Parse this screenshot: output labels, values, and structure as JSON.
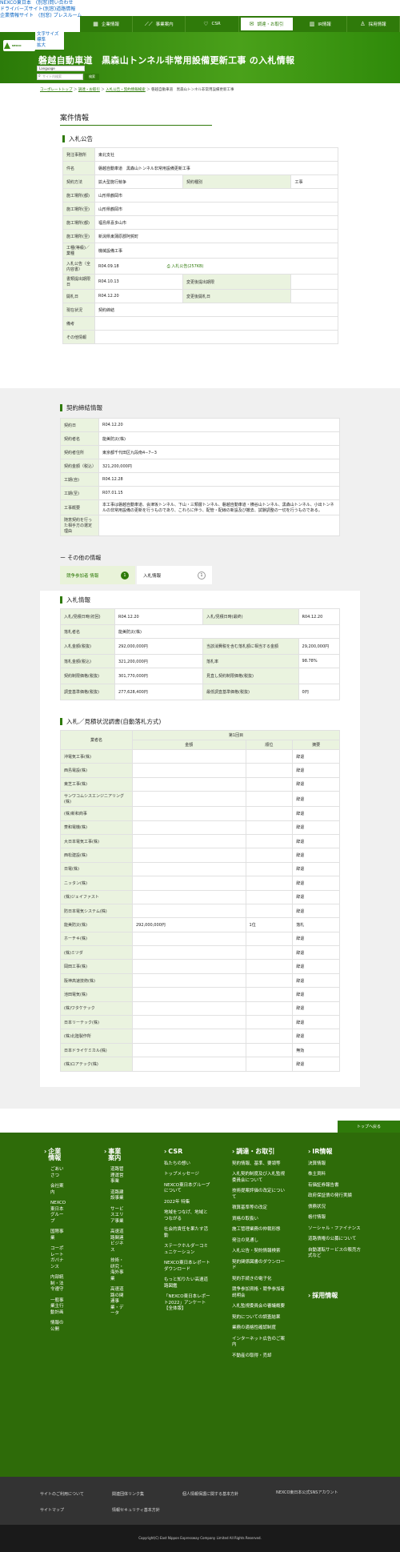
{
  "skip_links": [
    "NEXCO東日本　(別窓)問い合わせ",
    "ドライバーズサイト(別窓)道路情報",
    "企業情報サイト　(別窓) プレスルーム"
  ],
  "font_size": {
    "label": "文字サイズ",
    "standard": "標準",
    "large": "拡大"
  },
  "nav": [
    {
      "icon": "▦",
      "label": "企業情報"
    },
    {
      "icon": "⟋⟋",
      "label": "事業案内"
    },
    {
      "icon": "♡",
      "label": "CSR"
    },
    {
      "icon": "✉",
      "label": "調達・お取引"
    },
    {
      "icon": "▥",
      "label": "IR情報"
    },
    {
      "icon": "♙",
      "label": "採用情報"
    }
  ],
  "hero": {
    "title": "磐越自動車道　黒森山トンネル非常用設備更新工事 の入札情報"
  },
  "search": {
    "language": "Language",
    "placeholder": "サイト内検索",
    "button": "検索"
  },
  "breadcrumb": [
    "コーポレートトップ",
    "調達・お取引",
    "入札公告・契約情報検索",
    "磐越自動車道　黒森山トンネル非常用設備更新工事"
  ],
  "page_title": "案件情報",
  "notice": {
    "title": "入札公告",
    "rows": [
      {
        "label": "発注事務所",
        "value": "東北支社"
      },
      {
        "label": "件名",
        "value": "磐越自動車道　黒森山トンネル非常用設備更新工事"
      },
      {
        "label": "契約方法",
        "value": "拡大型施行競争",
        "label2": "契約種別",
        "value2": "工事"
      },
      {
        "label": "施工場所(都)",
        "value": "山形県鶴岡市"
      },
      {
        "label": "施工場所(至)",
        "value": "山形県鶴岡市"
      },
      {
        "label": "施工場所(都)",
        "value": "福島県喜多山市"
      },
      {
        "label": "施工場所(至)",
        "value": "新潟県東蒲原郡阿賀町"
      },
      {
        "label": "工種(等級)／業種",
        "value": "機械設備工事"
      },
      {
        "label": "入札公告（全内容書）",
        "value": "R04.09.18",
        "attach": "入札公告(257KB)"
      },
      {
        "label": "書類提出期限日",
        "value": "R04.10.13",
        "label2": "変更後提出期限",
        "value2": ""
      },
      {
        "label": "開札日",
        "value": "R04.12.20",
        "label2": "変更後開札日",
        "value2": ""
      },
      {
        "label": "現在状況",
        "value": "契約締結"
      },
      {
        "label": "備考",
        "value": ""
      },
      {
        "label": "その他情報",
        "value": ""
      }
    ]
  },
  "contract": {
    "title": "契約締結情報",
    "rows": [
      {
        "label": "契約日",
        "value": "R04.12.20"
      },
      {
        "label": "契約者名",
        "value": "能美防災(株)"
      },
      {
        "label": "契約者住所",
        "value": "東京都千代田区九段南4−7−3"
      },
      {
        "label": "契約金額（税込）",
        "value": "321,200,000円"
      },
      {
        "label": "工期(自)",
        "value": "R04.12.28"
      },
      {
        "label": "工期(至)",
        "value": "R07.01.15"
      },
      {
        "label": "工事概要",
        "value": "本工事は磐越自動車道、会津坂トンネル、下山・三類層トンネル、磐越自動車道・横谷山トンネル、黒森山トンネル、小出トンネルの非常用設備の更新を行うものであり、これらに伴う、配管・配線の新設及び撤去、試験調整の一切を行うものである。"
      },
      {
        "label": "随意契約を行った相手方の選定理由",
        "value": ""
      }
    ]
  },
  "other_title": "その他の情報",
  "tabs": [
    {
      "label": "競争参加者 情報",
      "count": "1"
    },
    {
      "label": "入札情報",
      "count": "1"
    }
  ],
  "bid": {
    "title": "入札情報",
    "rows": [
      {
        "label": "入札/見積日時(初回)",
        "value": "R04.12.20",
        "label2": "入札/見積日時(最終)",
        "value2": "R04.12.20"
      },
      {
        "label": "落札者名",
        "value": "能美防災(株)"
      },
      {
        "label": "入札金額(税抜)",
        "value": "292,000,000円",
        "label2": "当該消費税を含む落札額に相当する金額",
        "value2": "29,200,000円"
      },
      {
        "label": "落札金額(税込)",
        "value": "321,200,000円",
        "label2": "落札率",
        "value2": "98.78%"
      },
      {
        "label": "契約制限価格(税抜)",
        "value": "301,770,000円",
        "label2": "見直し契約制限価格(税抜)",
        "value2": ""
      },
      {
        "label": "調査基準価格(税抜)",
        "value": "277,628,400円",
        "label2": "最低調査基準価格(税抜)",
        "value2": "0円"
      }
    ]
  },
  "result": {
    "title": "入札／見積状況調書(自動落札方式)",
    "col_name": "業者名",
    "round": "第1回目",
    "cols": [
      "金額",
      "順位",
      "摘要"
    ],
    "rows": [
      {
        "name": "沖電気工事(株)",
        "amount": "",
        "rank": "",
        "note": "辞退"
      },
      {
        "name": "西島電設(株)",
        "amount": "",
        "rank": "",
        "note": "辞退"
      },
      {
        "name": "東芝工事(株)",
        "amount": "",
        "rank": "",
        "note": "辞退"
      },
      {
        "name": "サンワコムシスエンジニアリング(株)",
        "amount": "",
        "rank": "",
        "note": "辞退"
      },
      {
        "name": "(株)新和商事",
        "amount": "",
        "rank": "",
        "note": "辞退"
      },
      {
        "name": "菱和電機(株)",
        "amount": "",
        "rank": "",
        "note": "辞退"
      },
      {
        "name": "大日本電気工事(株)",
        "amount": "",
        "rank": "",
        "note": "辞退"
      },
      {
        "name": "西松建設(株)",
        "amount": "",
        "rank": "",
        "note": "辞退"
      },
      {
        "name": "日電(株)",
        "amount": "",
        "rank": "",
        "note": "辞退"
      },
      {
        "name": "ニッタン(株)",
        "amount": "",
        "rank": "",
        "note": "辞退"
      },
      {
        "name": "(株)ジェイファスト",
        "amount": "",
        "rank": "",
        "note": "辞退"
      },
      {
        "name": "防日本電気システム(株)",
        "amount": "",
        "rank": "",
        "note": "辞退"
      },
      {
        "name": "能美防災(株)",
        "amount": "292,000,000円",
        "rank": "1位",
        "note": "落札"
      },
      {
        "name": "ホーチキ(株)",
        "amount": "",
        "rank": "",
        "note": "辞退"
      },
      {
        "name": "(株)ミツダ",
        "amount": "",
        "rank": "",
        "note": "辞退"
      },
      {
        "name": "岡田工事(株)",
        "amount": "",
        "rank": "",
        "note": "辞退"
      },
      {
        "name": "阪神高速技術(株)",
        "amount": "",
        "rank": "",
        "note": "辞退"
      },
      {
        "name": "池田電気(株)",
        "amount": "",
        "rank": "",
        "note": "辞退"
      },
      {
        "name": "(株)ワタケテック",
        "amount": "",
        "rank": "",
        "note": "辞退"
      },
      {
        "name": "日本リーテック(株)",
        "amount": "",
        "rank": "",
        "note": "辞退"
      },
      {
        "name": "(株)北陸製作所",
        "amount": "",
        "rank": "",
        "note": "辞退"
      },
      {
        "name": "日本ドライケミカル(株)",
        "amount": "",
        "rank": "",
        "note": "無効"
      },
      {
        "name": "(株)ロアテック(株)",
        "amount": "",
        "rank": "",
        "note": "辞退"
      }
    ]
  },
  "to_top": "トップへ戻る",
  "footer_cols": [
    {
      "title": "企業情報",
      "items": [
        "ごあいさつ",
        "会社案内",
        "NEXCO東日本グループ",
        "国際事業",
        "コーポレートガバナンス",
        "内部統制・法令遵守",
        "一般事業主行動計画",
        "情報の公開"
      ]
    },
    {
      "title": "事業案内",
      "items": [
        "道路管理運営事業",
        "道路建設事業",
        "サービスエリア事業",
        "高速道路関連ビジネス",
        "技術・研究・海外事業",
        "高速道路の関連事業・データ"
      ]
    },
    {
      "title": "CSR",
      "items": [
        "私たちの想い",
        "トップメッセージ",
        "NEXCO東日本グループについて",
        "2022年 特集",
        "地域をつなげ、地域とつながる",
        "社会的責任を果たす活動",
        "ステークホルダーコミュニケーション",
        "NEXCO東日本レポートダウンロード",
        "もっと知りたい高速道路図鑑",
        "「NEXCO東日本レポート2022」アンケート【全体版】"
      ]
    },
    {
      "title": "調達・お取引",
      "items": [
        "契約情報、基準、要領等",
        "入札契約制度及び入札監視委員会について",
        "技術提案評価の改定について",
        "積算基準等の改定",
        "資格の取扱い",
        "施工管理業務の仲裁形態",
        "発注の見通し",
        "入札公告・契約情報検索",
        "契約関係図書のダウンロード",
        "契約手続きの電子化",
        "競争参加資格・競争参加者説明会",
        "入札監視委員会の審議概要",
        "契約についての調査結果",
        "業務の適格性確認制度",
        "インターネット広告のご案内",
        "不動産の取得・売却"
      ]
    },
    {
      "title": "IR情報",
      "items": [
        "決算情報",
        "株主資料",
        "有価証券報告書",
        "政府保証債の発行実績",
        "債務状況",
        "格付情報",
        "ソーシャル・ファイナンス",
        "道路債権の公募について",
        "自動運転サービスの販売方式など"
      ]
    },
    {
      "title": "採用情報",
      "items": []
    }
  ],
  "footer_links": [
    "サイトのご利用について",
    "関連団体リンク集",
    "個人情報保護に関する基本方針",
    "NEXCO東日本公式SNSアカウント",
    "サイトマップ",
    "情報セキュリティ基本方針"
  ],
  "copyright": "Copyright(C) East Nippon Expressway Company Limited All Rights Reserved."
}
